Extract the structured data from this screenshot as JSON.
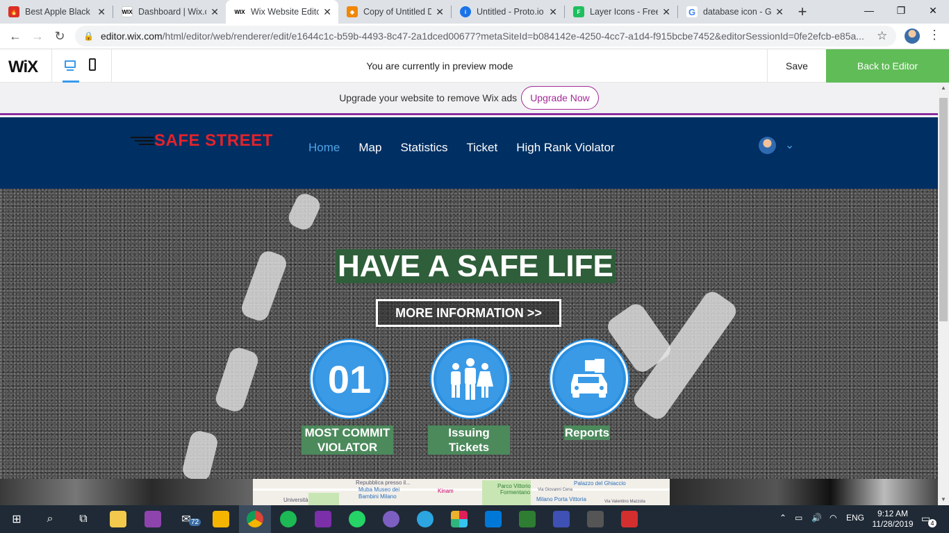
{
  "browser": {
    "tabs": [
      {
        "label": "Best Apple Black F",
        "favicon": "flame-icon",
        "active": false
      },
      {
        "label": "Dashboard | Wix.c",
        "favicon": "wix-icon",
        "active": false
      },
      {
        "label": "Wix Website Edito",
        "favicon": "wix-icon",
        "active": true
      },
      {
        "label": "Copy of Untitled D",
        "favicon": "drawio-icon",
        "active": false
      },
      {
        "label": "Untitled - Proto.io",
        "favicon": "protoio-icon",
        "active": false
      },
      {
        "label": "Layer Icons - Free",
        "favicon": "flaticon-icon",
        "active": false
      },
      {
        "label": "database icon - Go",
        "favicon": "google-icon",
        "active": false
      }
    ],
    "url_domain": "editor.wix.com",
    "url_path": "/html/editor/web/renderer/edit/e1644c1c-b59b-4493-8c47-2a1dced00677?metaSiteId=b084142e-4250-4cc7-a1d4-f915bcbe7452&editorSessionId=0fe2efcb-e85a..."
  },
  "wix": {
    "logo": "WiX",
    "preview_message": "You are currently in preview mode",
    "save_label": "Save",
    "back_label": "Back to Editor",
    "accent": "#3899ec",
    "back_color": "#60bc57"
  },
  "upgrade": {
    "message": "Upgrade your website to remove Wix ads",
    "button": "Upgrade Now"
  },
  "site": {
    "logo": "SAFE STREET",
    "nav": [
      "Home",
      "Map",
      "Statistics",
      "Ticket",
      "High Rank Violator"
    ],
    "active_nav": "Home",
    "header_color": "#002f63"
  },
  "hero": {
    "title": "HAVE A SAFE LIFE",
    "more_button": "MORE INFORMATION >>",
    "features": [
      {
        "icon": "number-01",
        "number": "01",
        "label_lines": [
          "MOST COMMIT",
          "VIOLATOR"
        ]
      },
      {
        "icon": "people-group-icon",
        "label_lines": [
          "Issuing Tickets"
        ]
      },
      {
        "icon": "car-report-icon",
        "label_lines": [
          "Reports"
        ]
      }
    ]
  },
  "map": {
    "labels": [
      "Repubblica presso il...",
      "Muba Museo dei",
      "Bambini Milano",
      "Università",
      "Kinam",
      "Parco Vittorio",
      "Formentano",
      "Via Giovanni Cena",
      "Palazzo del Ghiaccio",
      "Milano Porta Vittoria",
      "Via Valentino Mazzola"
    ]
  },
  "taskbar": {
    "mail_badge": "72",
    "tray_language": "ENG",
    "time": "9:12 AM",
    "date": "11/28/2019",
    "notifications": "4"
  }
}
